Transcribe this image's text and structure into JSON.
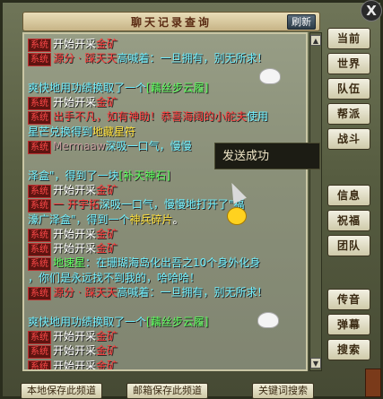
{
  "window": {
    "title": "聊天记录查询",
    "refresh_label": "刷新",
    "close_label": "X"
  },
  "channels": [
    "当前",
    "世界",
    "队伍",
    "帮派",
    "战斗",
    "信息",
    "祝福",
    "团队",
    "传音",
    "弹幕",
    "搜索"
  ],
  "popup": {
    "text": "发送成功"
  },
  "bottom_buttons": [
    "本地保存此频道",
    "邮箱保存此频道",
    "关键词搜索"
  ],
  "log": [
    [
      {
        "t": "tag",
        "v": "系统"
      },
      {
        "t": "white",
        "v": "开始开采"
      },
      {
        "t": "red",
        "v": "金矿"
      }
    ],
    [
      {
        "t": "tag",
        "v": "系统"
      },
      {
        "t": "red",
        "v": "源分 · 踩天天"
      },
      {
        "t": "cyan",
        "v": "高喊着：一旦拥有，别无所求！"
      }
    ],
    [],
    [
      {
        "t": "cyan",
        "v": "爽快地用功绩换取了一个"
      },
      {
        "t": "green",
        "v": "[藕丝步云履]"
      }
    ],
    [
      {
        "t": "tag",
        "v": "系统"
      },
      {
        "t": "white",
        "v": "开始开采"
      },
      {
        "t": "red",
        "v": "金矿"
      }
    ],
    [
      {
        "t": "tag",
        "v": "系统"
      },
      {
        "t": "red",
        "v": "出手不凡，如有神助！恭喜"
      },
      {
        "t": "red",
        "v": "海阔的小舵夫"
      },
      {
        "t": "cyan",
        "v": "使用"
      }
    ],
    [
      {
        "t": "cyan",
        "v": "星芒兑换得到"
      },
      {
        "t": "yellow",
        "v": "地藏星符"
      }
    ],
    [
      {
        "t": "tag",
        "v": "系统"
      },
      {
        "t": "muted",
        "v": "Mermaaw"
      },
      {
        "t": "cyan",
        "v": "深吸一口气，慢慢"
      }
    ],
    [],
    [
      {
        "t": "cyan",
        "v": "泽盒\"，得到了一块"
      },
      {
        "t": "green",
        "v": "[补天神石]"
      }
    ],
    [
      {
        "t": "tag",
        "v": "系统"
      },
      {
        "t": "white",
        "v": "开始开采"
      },
      {
        "t": "red",
        "v": "金矿"
      }
    ],
    [
      {
        "t": "tag",
        "v": "系统"
      },
      {
        "t": "red",
        "v": "一 开宇拓"
      },
      {
        "t": "cyan",
        "v": "深吸一口气，慢慢地打开了\"福"
      }
    ],
    [
      {
        "t": "cyan",
        "v": "濠广泽盒\"，得到一个"
      },
      {
        "t": "yellow",
        "v": "神兵碎片"
      },
      {
        "t": "white",
        "v": "。"
      }
    ],
    [
      {
        "t": "tag",
        "v": "系统"
      },
      {
        "t": "white",
        "v": "开始开采"
      },
      {
        "t": "red",
        "v": "金矿"
      }
    ],
    [
      {
        "t": "tag",
        "v": "系统"
      },
      {
        "t": "white",
        "v": "开始开采"
      },
      {
        "t": "red",
        "v": "金矿"
      }
    ],
    [
      {
        "t": "tag",
        "v": "系统"
      },
      {
        "t": "green",
        "v": "地速星"
      },
      {
        "t": "cyan",
        "v": "：在珊瑚海岛化出吾之10个身外化身"
      }
    ],
    [
      {
        "t": "cyan",
        "v": "，你们是永远找不到我的，哈哈哈！"
      }
    ],
    [
      {
        "t": "tag",
        "v": "系统"
      },
      {
        "t": "red",
        "v": "源分 · 踩天天"
      },
      {
        "t": "cyan",
        "v": "高喊着：一旦拥有，别无所求！"
      }
    ],
    [],
    [
      {
        "t": "cyan",
        "v": "爽快地用功绩换取了一个"
      },
      {
        "t": "green",
        "v": "[藕丝步云履]"
      }
    ],
    [
      {
        "t": "tag",
        "v": "系统"
      },
      {
        "t": "white",
        "v": "开始开采"
      },
      {
        "t": "red",
        "v": "金矿"
      }
    ],
    [
      {
        "t": "tag",
        "v": "系统"
      },
      {
        "t": "white",
        "v": "开始开采"
      },
      {
        "t": "red",
        "v": "金矿"
      }
    ],
    [
      {
        "t": "tag",
        "v": "系统"
      },
      {
        "t": "white",
        "v": "开始开采"
      },
      {
        "t": "red",
        "v": "金矿"
      }
    ]
  ]
}
